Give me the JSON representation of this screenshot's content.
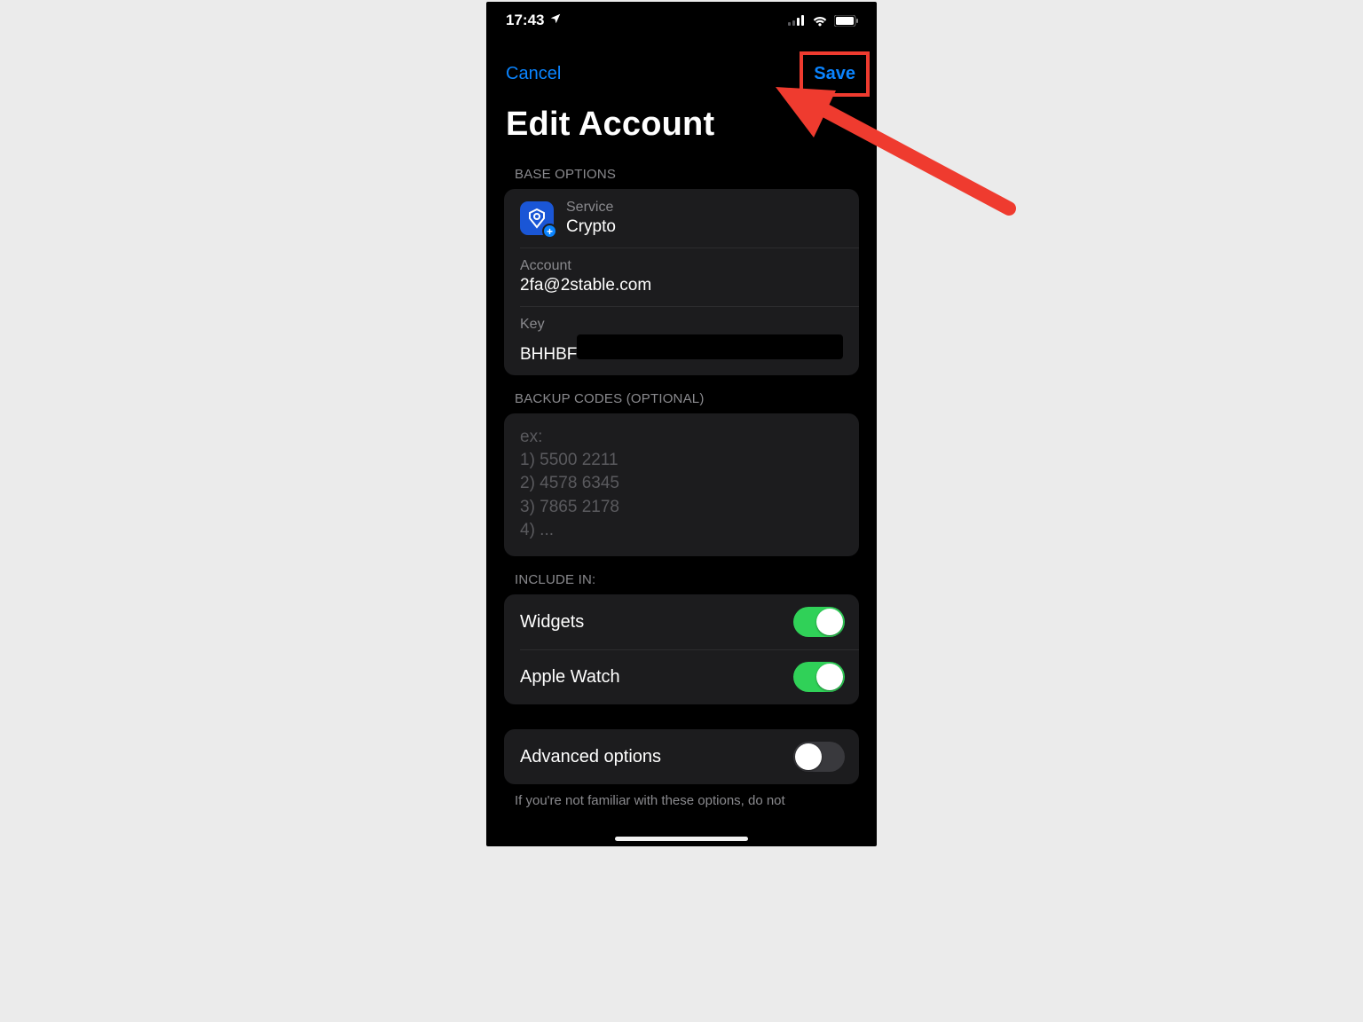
{
  "status": {
    "time": "17:43"
  },
  "nav": {
    "cancel": "Cancel",
    "save": "Save"
  },
  "title": "Edit Account",
  "sections": {
    "base_header": "BASE OPTIONS",
    "backup_header": "BACKUP CODES (OPTIONAL)",
    "include_header": "INCLUDE IN:"
  },
  "base": {
    "service_label": "Service",
    "service_value": "Crypto",
    "account_label": "Account",
    "account_value": "2fa@2stable.com",
    "key_label": "Key",
    "key_visible": "BHHBF"
  },
  "backup_placeholder": "ex:\n1) 5500 2211\n2) 4578 6345\n3) 7865 2178\n4) ...",
  "include": {
    "widgets_label": "Widgets",
    "widgets_on": true,
    "applewatch_label": "Apple Watch",
    "applewatch_on": true
  },
  "advanced": {
    "label": "Advanced options",
    "on": false,
    "note": "If you're not familiar with these options, do not"
  }
}
